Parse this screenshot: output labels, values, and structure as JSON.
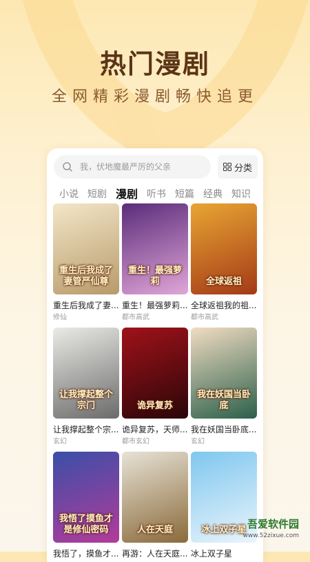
{
  "hero": {
    "title": "热门漫剧",
    "subtitle": "全网精彩漫剧畅快追更"
  },
  "search": {
    "placeholder": "我，伏地魔最严厉的父亲",
    "category_label": "分类"
  },
  "tabs": [
    {
      "label": "小说",
      "active": false
    },
    {
      "label": "短剧",
      "active": false
    },
    {
      "label": "漫剧",
      "active": true
    },
    {
      "label": "听书",
      "active": false
    },
    {
      "label": "短篇",
      "active": false
    },
    {
      "label": "经典",
      "active": false
    },
    {
      "label": "知识",
      "active": false
    }
  ],
  "cards": [
    {
      "title": "重生后我成了妻...",
      "tag": "修仙",
      "cover_text": "重生后我成了妻管严仙尊",
      "colors": [
        "#f3e6c8",
        "#b89a6a"
      ]
    },
    {
      "title": "重生！最强萝莉...",
      "tag": "都市高武",
      "cover_text": "重生！最强萝莉",
      "colors": [
        "#5b2c7a",
        "#e0a6d8"
      ]
    },
    {
      "title": "全球返祖我的祖...",
      "tag": "都市高武",
      "cover_text": "全球返祖",
      "colors": [
        "#e9a533",
        "#a33a17"
      ]
    },
    {
      "title": "让我撑起整个宗...",
      "tag": "玄幻",
      "cover_text": "让我撑起整个宗门",
      "colors": [
        "#eaeae6",
        "#6b6b6b"
      ]
    },
    {
      "title": "诡异复苏，天师...",
      "tag": "都市玄幻",
      "cover_text": "诡异复苏",
      "colors": [
        "#a0121a",
        "#2a0608"
      ]
    },
    {
      "title": "我在妖国当卧底...",
      "tag": "玄幻",
      "cover_text": "我在妖国当卧底",
      "colors": [
        "#f1dcc2",
        "#2b5f4a"
      ]
    },
    {
      "title": "我悟了，摸鱼才...",
      "tag": "",
      "cover_text": "我悟了摸鱼才是修仙密码",
      "colors": [
        "#3a4fa8",
        "#b33b9a"
      ]
    },
    {
      "title": "再游：人在天庭...",
      "tag": "",
      "cover_text": "人在天庭",
      "colors": [
        "#e7e2d6",
        "#8a6a3a"
      ]
    },
    {
      "title": "冰上双子星",
      "tag": "",
      "cover_text": "冰上双子星",
      "colors": [
        "#7fc7ef",
        "#e9f4fb"
      ]
    }
  ],
  "watermark": {
    "brand": "吾爱软件园",
    "url": "www.52zixue.com"
  },
  "theme": {
    "accent": "#5b3416",
    "background": "#fde8b3"
  }
}
